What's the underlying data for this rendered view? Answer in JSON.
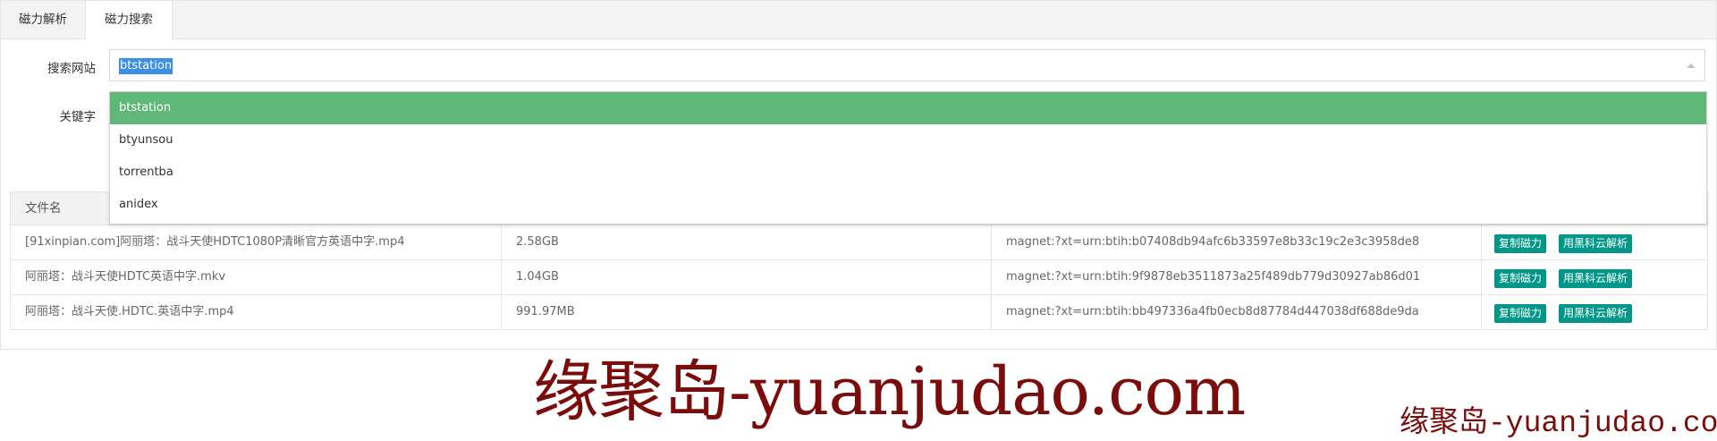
{
  "tabs": [
    {
      "label": "磁力解析",
      "active": false
    },
    {
      "label": "磁力搜索",
      "active": true
    }
  ],
  "form": {
    "site_label": "搜索网站",
    "keyword_label": "关键字",
    "site_value": "btstation",
    "site_options": [
      {
        "label": "btstation",
        "selected": true
      },
      {
        "label": "btyunsou",
        "selected": false
      },
      {
        "label": "torrentba",
        "selected": false
      },
      {
        "label": "anidex",
        "selected": false
      }
    ]
  },
  "table": {
    "columns": [
      "文件名"
    ],
    "rows": [
      {
        "name": "[91xinpian.com]阿丽塔：战斗天使HDTC1080P清晰官方英语中字.mp4",
        "size": "2.58GB",
        "magnet": "magnet:?xt=urn:btih:b07408db94afc6b33597e8b33c19c2e3c3958de8",
        "btn_copy": "复制磁力",
        "btn_parse": "用黑科云解析"
      },
      {
        "name": "阿丽塔：战斗天使HDTC英语中字.mkv",
        "size": "1.04GB",
        "magnet": "magnet:?xt=urn:btih:9f9878eb3511873a25f489db779d30927ab86d01",
        "btn_copy": "复制磁力",
        "btn_parse": "用黑科云解析"
      },
      {
        "name": "阿丽塔：战斗天使.HDTC.英语中字.mp4",
        "size": "991.97MB",
        "magnet": "magnet:?xt=urn:btih:bb497336a4fb0ecb8d87784d447038df688de9da",
        "btn_copy": "复制磁力",
        "btn_parse": "用黑科云解析"
      }
    ]
  },
  "watermark": {
    "big": "缘聚岛-yuanjudao.com",
    "small": "缘聚岛-yuanjudao.com"
  },
  "colors": {
    "selected_option": "#5fb878",
    "action_button": "#009688",
    "text_highlight": "#3b8fe6",
    "watermark": "#7a0c0c"
  }
}
